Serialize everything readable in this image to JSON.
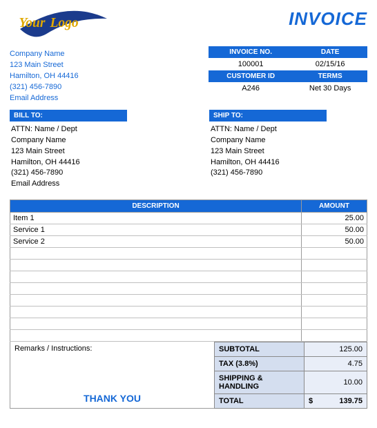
{
  "logo": {
    "text1": "Your",
    "text2": "Logo"
  },
  "title": "INVOICE",
  "company": {
    "name": "Company Name",
    "street": "123 Main Street",
    "city": "Hamilton, OH  44416",
    "phone": "(321) 456-7890",
    "email": "Email Address"
  },
  "meta": {
    "h_invoice_no": "INVOICE NO.",
    "h_date": "DATE",
    "invoice_no": "100001",
    "date": "02/15/16",
    "h_customer_id": "CUSTOMER ID",
    "h_terms": "TERMS",
    "customer_id": "A246",
    "terms": "Net 30 Days"
  },
  "bill_to": {
    "heading": "BILL TO:",
    "attn": "ATTN: Name / Dept",
    "company": "Company Name",
    "street": "123 Main Street",
    "city": "Hamilton, OH  44416",
    "phone": "(321) 456-7890",
    "email": "Email Address"
  },
  "ship_to": {
    "heading": "SHIP TO:",
    "attn": "ATTN: Name / Dept",
    "company": "Company Name",
    "street": "123 Main Street",
    "city": "Hamilton, OH  44416",
    "phone": "(321) 456-7890"
  },
  "items_header": {
    "description": "DESCRIPTION",
    "amount": "AMOUNT"
  },
  "items": [
    {
      "description": "Item 1",
      "amount": "25.00"
    },
    {
      "description": "Service 1",
      "amount": "50.00"
    },
    {
      "description": "Service 2",
      "amount": "50.00"
    },
    {
      "description": "",
      "amount": ""
    },
    {
      "description": "",
      "amount": ""
    },
    {
      "description": "",
      "amount": ""
    },
    {
      "description": "",
      "amount": ""
    },
    {
      "description": "",
      "amount": ""
    },
    {
      "description": "",
      "amount": ""
    },
    {
      "description": "",
      "amount": ""
    },
    {
      "description": "",
      "amount": ""
    }
  ],
  "remarks_label": "Remarks / Instructions:",
  "thank_you": "THANK YOU",
  "totals": {
    "subtotal_label": "SUBTOTAL",
    "subtotal": "125.00",
    "tax_label": "TAX (3.8%)",
    "tax": "4.75",
    "ship_label": "SHIPPING & HANDLING",
    "ship": "10.00",
    "total_label": "TOTAL",
    "total_currency": "$",
    "total": "139.75"
  }
}
